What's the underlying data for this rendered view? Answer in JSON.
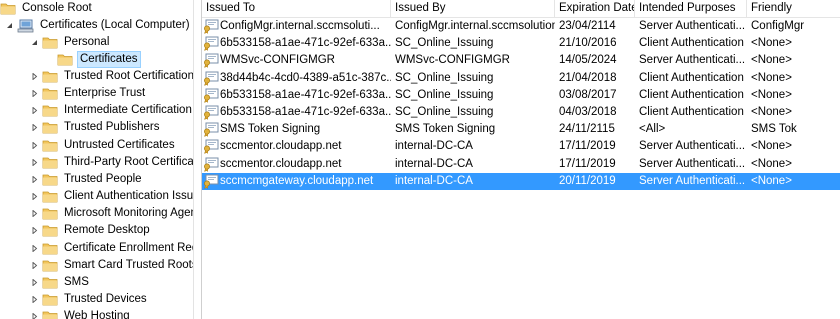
{
  "tree": {
    "console_root": "Console Root",
    "computer": "Certificates (Local Computer)",
    "personal": "Personal",
    "certificates": "Certificates",
    "stores": [
      "Trusted Root Certification A",
      "Enterprise Trust",
      "Intermediate Certification A",
      "Trusted Publishers",
      "Untrusted Certificates",
      "Third-Party Root Certificat",
      "Trusted People",
      "Client Authentication Issue",
      "Microsoft Monitoring Agen",
      "Remote Desktop",
      "Certificate Enrollment Requ",
      "Smart Card Trusted Roots",
      "SMS",
      "Trusted Devices",
      "Web Hosting"
    ]
  },
  "columns": [
    "Issued To",
    "Issued By",
    "Expiration Date",
    "Intended Purposes",
    "Friendly"
  ],
  "rows": [
    {
      "issued_to": "ConfigMgr.internal.sccmsoluti...",
      "issued_by": "ConfigMgr.internal.sccmsolution...",
      "expires": "23/04/2114",
      "purposes": "Server Authenticati...",
      "friendly": "ConfigMgr"
    },
    {
      "issued_to": "6b533158-a1ae-471c-92ef-633a...",
      "issued_by": "SC_Online_Issuing",
      "expires": "21/10/2016",
      "purposes": "Client Authentication",
      "friendly": "<None>"
    },
    {
      "issued_to": "WMSvc-CONFIGMGR",
      "issued_by": "WMSvc-CONFIGMGR",
      "expires": "14/05/2024",
      "purposes": "Server Authenticati...",
      "friendly": "<None>"
    },
    {
      "issued_to": "38d44b4c-4cd0-4389-a51c-387c...",
      "issued_by": "SC_Online_Issuing",
      "expires": "21/04/2018",
      "purposes": "Client Authentication",
      "friendly": "<None>"
    },
    {
      "issued_to": "6b533158-a1ae-471c-92ef-633a...",
      "issued_by": "SC_Online_Issuing",
      "expires": "03/08/2017",
      "purposes": "Client Authentication",
      "friendly": "<None>"
    },
    {
      "issued_to": "6b533158-a1ae-471c-92ef-633a...",
      "issued_by": "SC_Online_Issuing",
      "expires": "04/03/2018",
      "purposes": "Client Authentication",
      "friendly": "<None>"
    },
    {
      "issued_to": "SMS Token Signing",
      "issued_by": "SMS Token Signing",
      "expires": "24/11/2115",
      "purposes": "<All>",
      "friendly": "SMS Tok"
    },
    {
      "issued_to": "sccmentor.cloudapp.net",
      "issued_by": "internal-DC-CA",
      "expires": "17/11/2019",
      "purposes": "Server Authenticati...",
      "friendly": "<None>"
    },
    {
      "issued_to": "sccmentor.cloudapp.net",
      "issued_by": "internal-DC-CA",
      "expires": "17/11/2019",
      "purposes": "Server Authenticati...",
      "friendly": "<None>"
    },
    {
      "issued_to": "sccmcmgateway.cloudapp.net",
      "issued_by": "internal-DC-CA",
      "expires": "20/11/2019",
      "purposes": "Server Authenticati...",
      "friendly": "<None>"
    }
  ],
  "selected_row_index": 9,
  "icons": {
    "folder": "folder-icon",
    "computer": "computer-icon",
    "certificate": "certificate-icon",
    "expand": "expand-arrow-icon",
    "collapse": "collapse-arrow-icon"
  },
  "colors": {
    "selection": "#3399ff",
    "tree_selection": "#cce8ff",
    "folder": "#f2c55c"
  }
}
